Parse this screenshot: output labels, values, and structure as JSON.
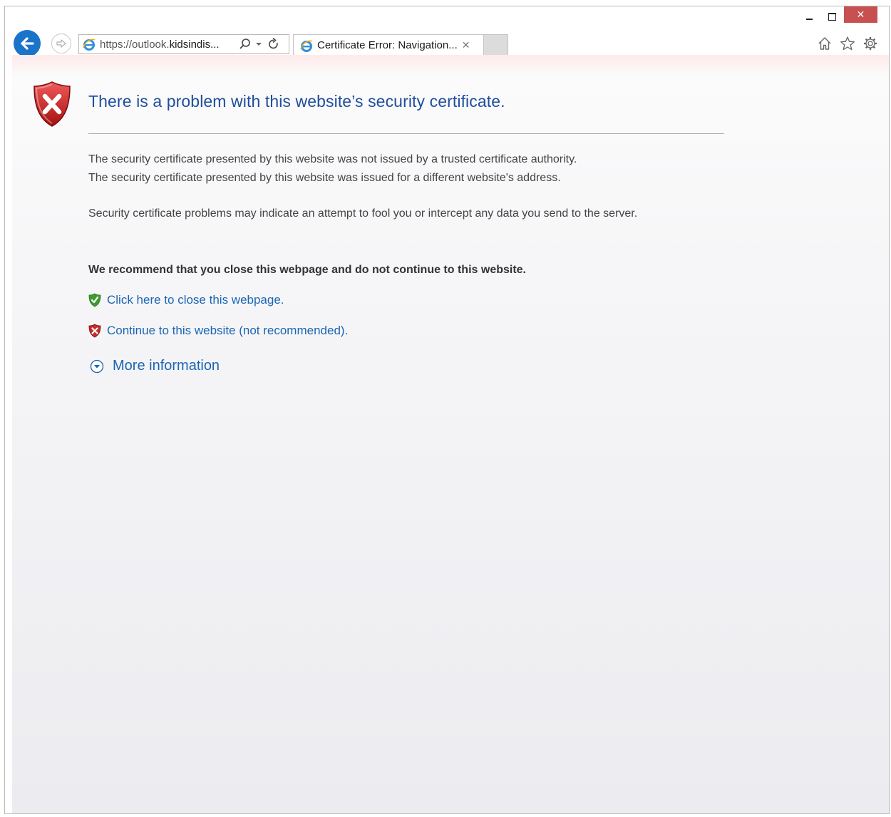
{
  "browser": {
    "address_bar": {
      "url_prefix": "https://outlook.",
      "url_domain": "kidsindis...",
      "search_icon": "search-icon",
      "dropdown_icon": "chevron-down-icon",
      "refresh_icon": "refresh-icon"
    },
    "tab": {
      "title": "Certificate Error: Navigation...",
      "close": "✕"
    },
    "toolbar_icons": [
      "home-icon",
      "star-icon",
      "gear-icon"
    ],
    "window_controls": {
      "close": "✕"
    }
  },
  "page": {
    "title": "There is a problem with this website’s security certificate.",
    "paragraph1_line1": "The security certificate presented by this website was not issued by a trusted certificate authority.",
    "paragraph1_line2": "The security certificate presented by this website was issued for a different website's address.",
    "paragraph2": "Security certificate problems may indicate an attempt to fool you or intercept any data you send to the server.",
    "recommendation": "We recommend that you close this webpage and do not continue to this website.",
    "close_link": "Click here to close this webpage.",
    "continue_link": "Continue to this website (not recommended).",
    "more_info": "More information"
  },
  "colors": {
    "title": "#1f4e9c",
    "link": "#1a66b3",
    "back_button": "#1a74c9",
    "close_button": "#c75050"
  }
}
